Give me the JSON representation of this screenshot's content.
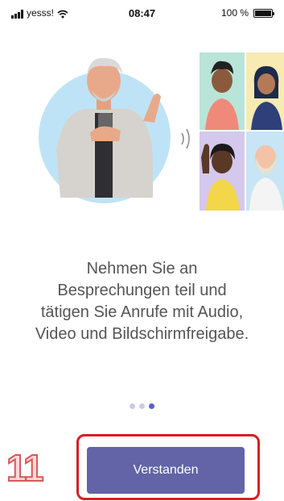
{
  "status_bar": {
    "carrier": "yesss!",
    "time": "08:47",
    "battery": "100 %"
  },
  "onboarding": {
    "message": "Nehmen Sie an Besprechungen teil und tätigen Sie Anrufe mit Audio, Video und Bildschirmfreigabe.",
    "page_count": 3,
    "active_page": 3,
    "button_label": "Verstanden"
  },
  "annotation": {
    "step": "11",
    "color": "#d91d25"
  },
  "colors": {
    "accent": "#6264a7",
    "dot_inactive": "#c9cbe6"
  }
}
